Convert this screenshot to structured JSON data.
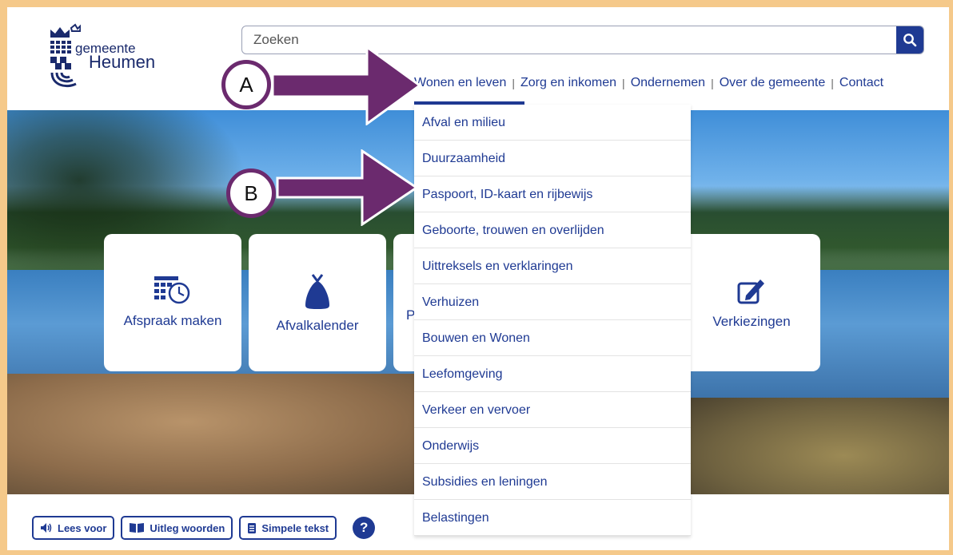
{
  "logo": {
    "line1": "gemeente",
    "line2": "Heumen"
  },
  "search": {
    "placeholder": "Zoeken",
    "icon": "search-icon"
  },
  "nav": {
    "items": [
      "Wonen en leven",
      "Zorg en inkomen",
      "Ondernemen",
      "Over de gemeente",
      "Contact"
    ],
    "separator": "|"
  },
  "dropdown": {
    "items": [
      "Afval en milieu",
      "Duurzaamheid",
      "Paspoort, ID-kaart en rijbewijs",
      "Geboorte, trouwen en overlijden",
      "Uittreksels en verklaringen",
      "Verhuizen",
      "Bouwen en Wonen",
      "Leefomgeving",
      "Verkeer en vervoer",
      "Onderwijs",
      "Subsidies en leningen",
      "Belastingen"
    ]
  },
  "tiles": [
    {
      "label": "Afspraak maken",
      "icon": "calendar-clock-icon"
    },
    {
      "label": "Afvalkalender",
      "icon": "waste-bag-icon"
    },
    {
      "label": "P",
      "icon": ""
    },
    {
      "label": "Verkiezingen",
      "icon": "ballot-pencil-icon"
    }
  ],
  "annotations": {
    "a": "A",
    "b": "B"
  },
  "toolbar": {
    "read_aloud": "Lees voor",
    "glossary": "Uitleg woorden",
    "simple_text": "Simpele tekst",
    "help": "?"
  },
  "colors": {
    "primary": "#1f3a93",
    "frame": "#f5c98a",
    "annotation": "#6b2a6e"
  }
}
